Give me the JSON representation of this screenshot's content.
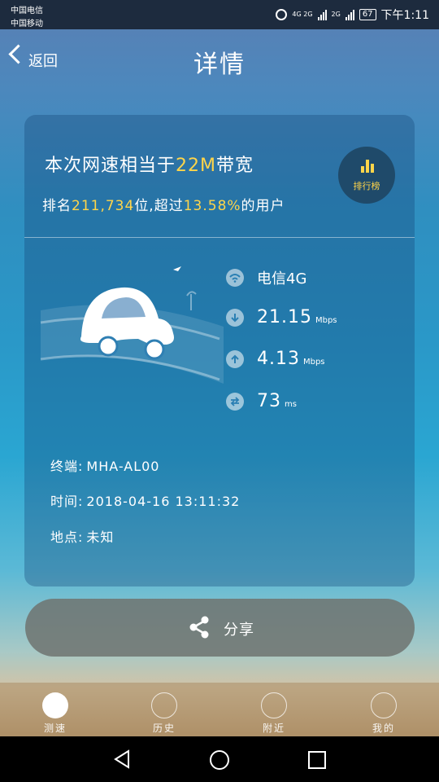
{
  "status_bar": {
    "carrier_1": "中国电信",
    "carrier_2": "中国移动",
    "network_1": "4G 2G",
    "network_2": "2G",
    "battery": "67",
    "time": "下午1:11"
  },
  "header": {
    "back_label": "返回",
    "title": "详情"
  },
  "summary": {
    "headline_prefix": "本次网速相当于",
    "bandwidth": "22M",
    "headline_suffix": "带宽",
    "rank_prefix": "排名",
    "rank_value": "211,734",
    "rank_mid": "位,超过",
    "percent": "13.58%",
    "rank_suffix": "的用户",
    "rank_button_label": "排行榜"
  },
  "metrics": {
    "carrier": "电信4G",
    "download": "21.15",
    "download_unit": "Mbps",
    "upload": "4.13",
    "upload_unit": "Mbps",
    "ping": "73",
    "ping_unit": "ms"
  },
  "details": {
    "terminal_label": "终端:",
    "terminal_value": "MHA-AL00",
    "time_label": "时间:",
    "time_value": "2018-04-16 13:11:32",
    "location_label": "地点:",
    "location_value": "未知"
  },
  "share": {
    "label": "分享"
  },
  "tabs": [
    {
      "label": "测速",
      "active": true
    },
    {
      "label": "历史",
      "active": false
    },
    {
      "label": "附近",
      "active": false
    },
    {
      "label": "我的",
      "active": false
    }
  ],
  "colors": {
    "accent": "#ffd54a"
  }
}
